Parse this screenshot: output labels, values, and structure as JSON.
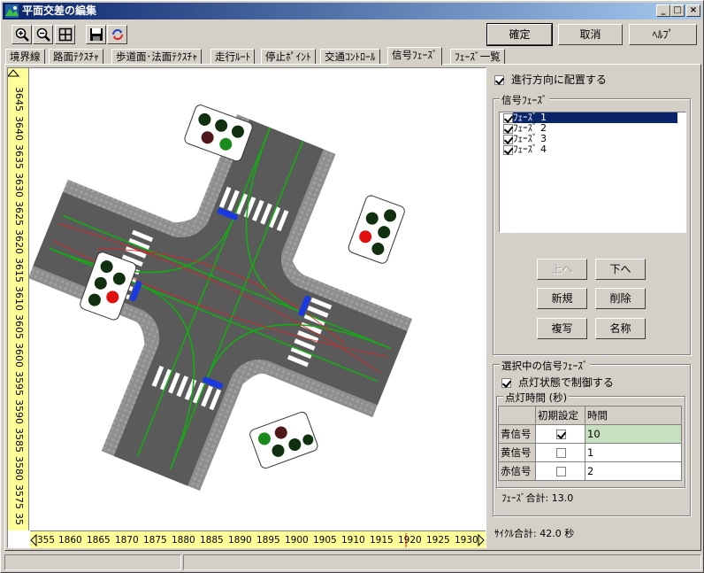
{
  "window": {
    "title": "平面交差の編集"
  },
  "titlebar_buttons": {
    "minimize": "_",
    "maximize": "□",
    "close": "×"
  },
  "toolbar": {
    "tools": [
      "zoom-in-icon",
      "zoom-out-icon",
      "fit-icon",
      "save-icon",
      "refresh-icon"
    ]
  },
  "actions": {
    "ok": "確定",
    "cancel": "取消",
    "help": "ﾍﾙﾌﾟ"
  },
  "tabs": [
    {
      "label": "境界線"
    },
    {
      "label": "路面ﾃｸｽﾁｬ"
    },
    {
      "label": "歩道面･法面ﾃｸｽﾁｬ"
    },
    {
      "label": "走行ﾙｰﾄ"
    },
    {
      "label": "停止ﾎﾟｲﾝﾄ"
    },
    {
      "label": "交通ｺﾝﾄﾛｰﾙ"
    },
    {
      "label": "信号ﾌｪｰｽﾞ"
    },
    {
      "label": "ﾌｪｰｽﾞ一覧"
    }
  ],
  "options": {
    "align_direction": "進行方向に配置する"
  },
  "phases_group": {
    "label": "信号ﾌｪｰｽﾞ",
    "items": [
      "ﾌｪｰｽﾞ 1",
      "ﾌｪｰｽﾞ 2",
      "ﾌｪｰｽﾞ 3",
      "ﾌｪｰｽﾞ 4"
    ]
  },
  "phase_buttons": {
    "up": "上へ",
    "down": "下へ",
    "new": "新規",
    "delete": "削除",
    "copy": "複写",
    "rename": "名称"
  },
  "selected_group": {
    "label": "選択中の信号ﾌｪｰｽﾞ",
    "control_by_light": "点灯状態で制御する",
    "timing_label": "点灯時間 (秒)",
    "columns": [
      "初期設定",
      "時間"
    ],
    "rows": [
      {
        "name": "青信号",
        "initial": true,
        "time": "10"
      },
      {
        "name": "黄信号",
        "initial": false,
        "time": "1"
      },
      {
        "name": "赤信号",
        "initial": false,
        "time": "2"
      }
    ],
    "total": "ﾌｪｰｽﾞ合計: 13.0"
  },
  "cycle_total": "ｻｲｸﾙ合計: 42.0 秒",
  "vruler": {
    "ticks": [
      "3645",
      "3640",
      "3635",
      "3630",
      "3625",
      "3620",
      "3615",
      "3610",
      "3605",
      "3600",
      "3595",
      "3590",
      "3585",
      "3580",
      "3575",
      "35"
    ]
  },
  "hruler": {
    "ticks": [
      "355",
      "1860",
      "1865",
      "1870",
      "1875",
      "1880",
      "1885",
      "1890",
      "1895",
      "1900",
      "1905",
      "1910",
      "1915",
      "1920",
      "1925",
      "1930"
    ]
  },
  "colors": {
    "title_start": "#0a246a",
    "ruler": "#ffff99",
    "selected_row": "#c6e0c0",
    "road": "#5a5a5a",
    "sidewalk": "#9a9a9a"
  }
}
